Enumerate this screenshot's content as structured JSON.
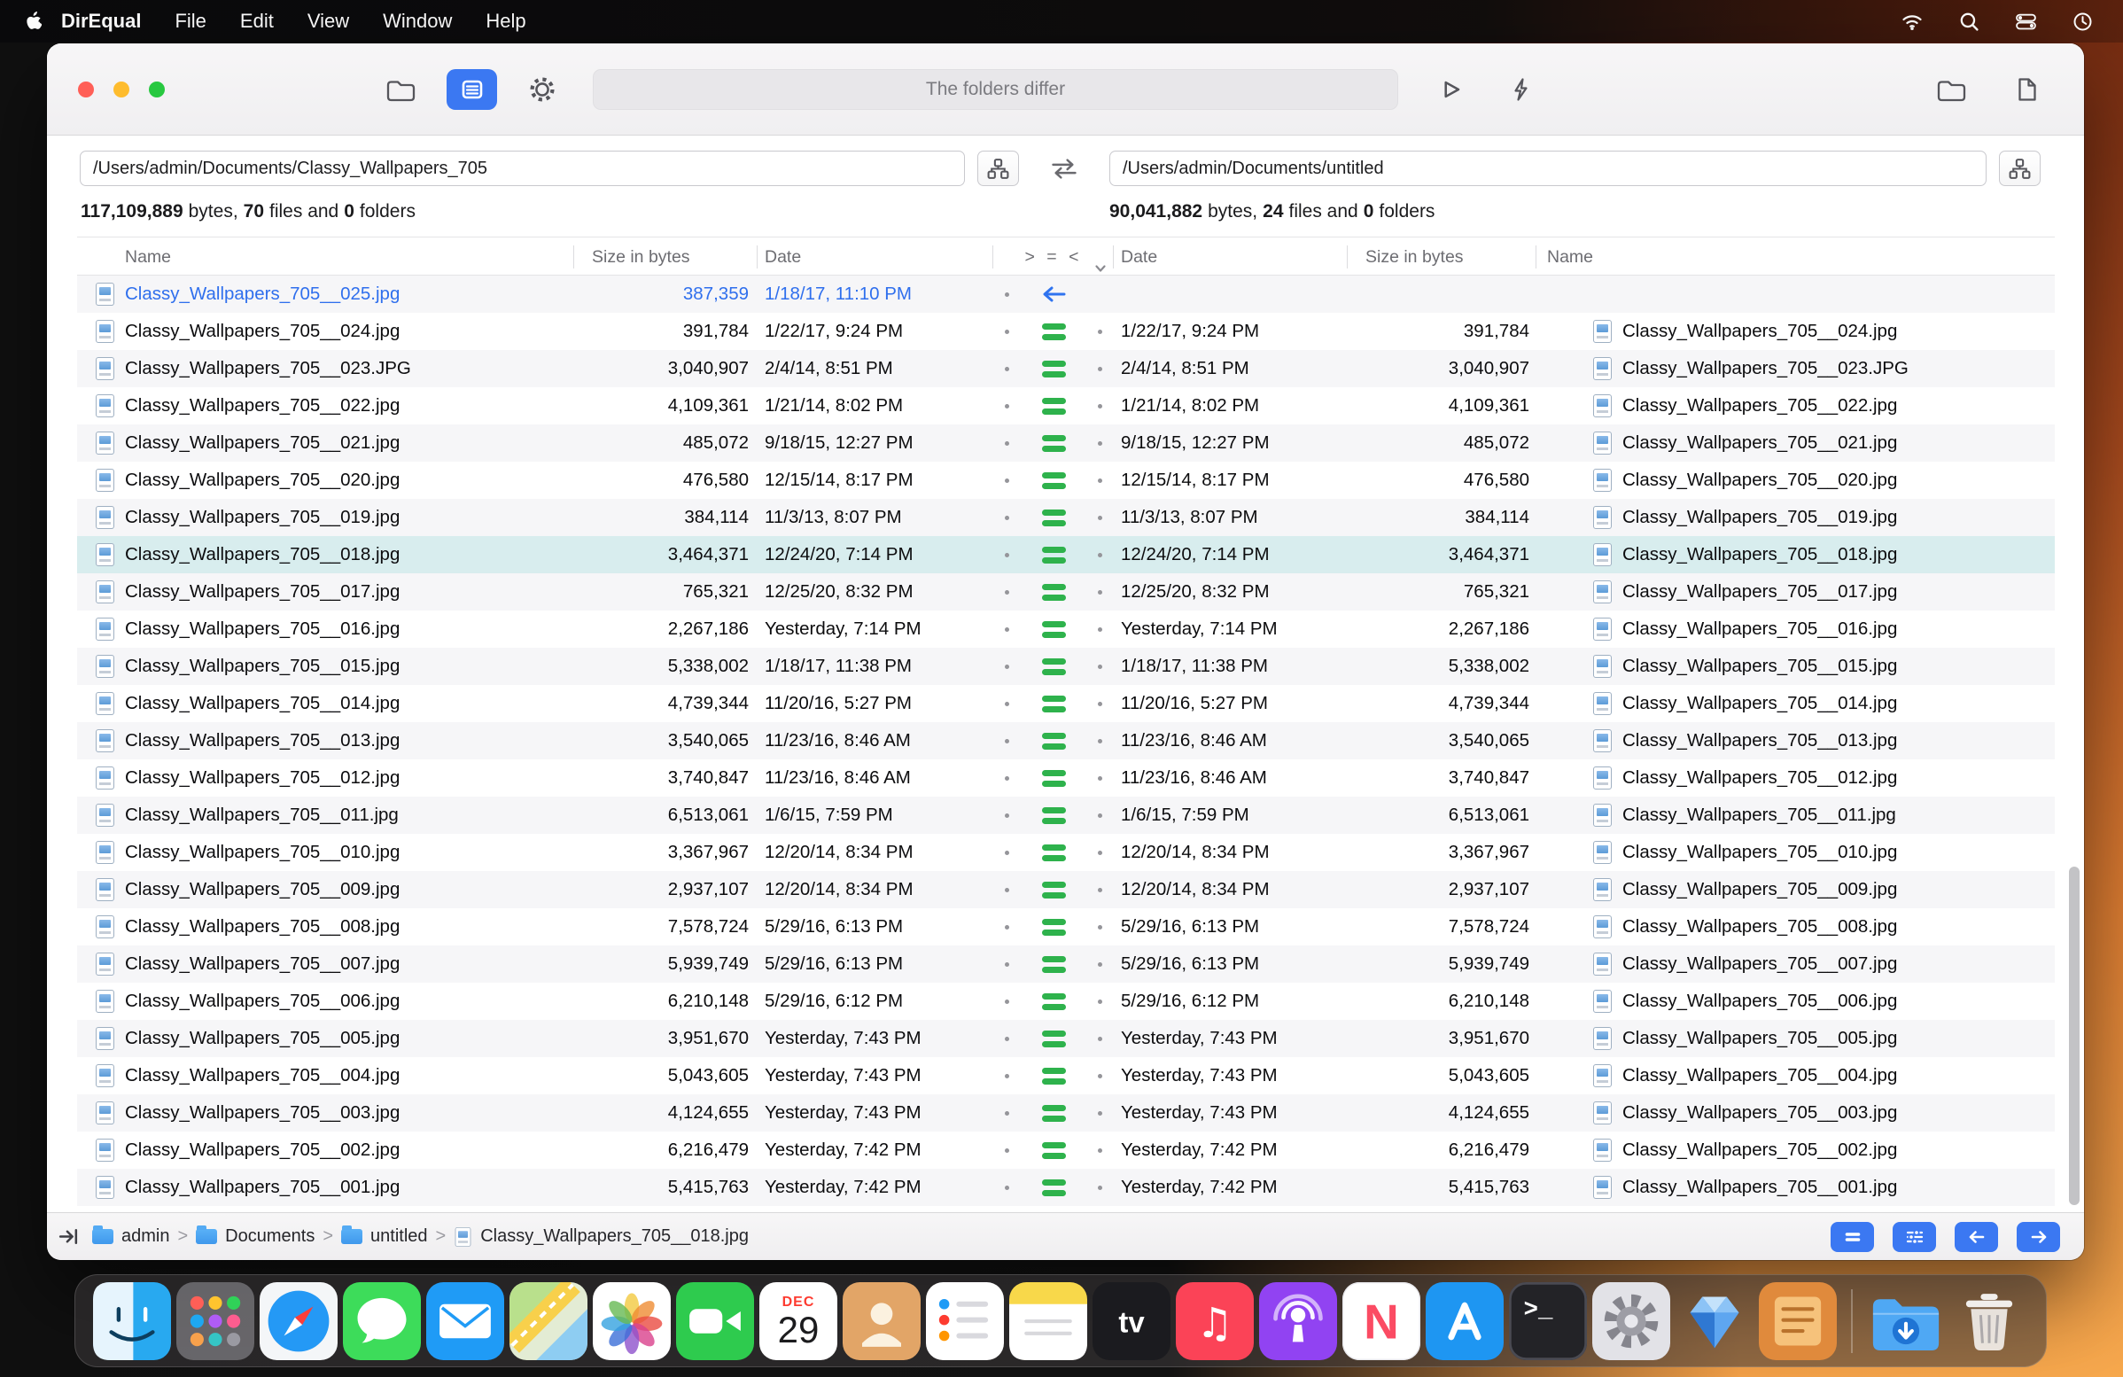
{
  "menubar": {
    "app_name": "DirEqual",
    "menus": [
      "File",
      "Edit",
      "View",
      "Window",
      "Help"
    ],
    "status_icons": [
      "wifi-icon",
      "spotlight-search-icon",
      "control-center-icon",
      "clock-icon"
    ]
  },
  "toolbar": {
    "status_message": "The folders differ",
    "buttons": [
      "select-folders",
      "compare-view",
      "settings",
      "run-compare",
      "quick-compare",
      "reveal-left-folder",
      "reveal-selected-file"
    ]
  },
  "panes": {
    "left": {
      "path": "/Users/admin/Documents/Classy_Wallpapers_705",
      "stats": {
        "bytes": "117,109,889",
        "bytes_label": "bytes,",
        "files": "70",
        "files_label": "files and",
        "folders": "0",
        "folders_label": "folders"
      }
    },
    "right": {
      "path": "/Users/admin/Documents/untitled",
      "stats": {
        "bytes": "90,041,882",
        "bytes_label": "bytes,",
        "files": "24",
        "files_label": "files and",
        "folders": "0",
        "folders_label": "folders"
      }
    }
  },
  "table": {
    "headers": {
      "name_left": "Name",
      "size_left": "Size in bytes",
      "date_left": "Date",
      "compare": "> = <",
      "date_right": "Date",
      "size_right": "Size in bytes",
      "name_right": "Name"
    },
    "rows": [
      {
        "status": "left_only",
        "selected": false,
        "left": {
          "name": "Classy_Wallpapers_705__025.jpg",
          "size": "387,359",
          "date": "1/18/17, 11:10 PM"
        },
        "right": null
      },
      {
        "status": "equal",
        "selected": false,
        "left": {
          "name": "Classy_Wallpapers_705__024.jpg",
          "size": "391,784",
          "date": "1/22/17, 9:24 PM"
        },
        "right": {
          "name": "Classy_Wallpapers_705__024.jpg",
          "size": "391,784",
          "date": "1/22/17, 9:24 PM"
        }
      },
      {
        "status": "equal",
        "selected": false,
        "left": {
          "name": "Classy_Wallpapers_705__023.JPG",
          "size": "3,040,907",
          "date": "2/4/14, 8:51 PM"
        },
        "right": {
          "name": "Classy_Wallpapers_705__023.JPG",
          "size": "3,040,907",
          "date": "2/4/14, 8:51 PM"
        }
      },
      {
        "status": "equal",
        "selected": false,
        "left": {
          "name": "Classy_Wallpapers_705__022.jpg",
          "size": "4,109,361",
          "date": "1/21/14, 8:02 PM"
        },
        "right": {
          "name": "Classy_Wallpapers_705__022.jpg",
          "size": "4,109,361",
          "date": "1/21/14, 8:02 PM"
        }
      },
      {
        "status": "equal",
        "selected": false,
        "left": {
          "name": "Classy_Wallpapers_705__021.jpg",
          "size": "485,072",
          "date": "9/18/15, 12:27 PM"
        },
        "right": {
          "name": "Classy_Wallpapers_705__021.jpg",
          "size": "485,072",
          "date": "9/18/15, 12:27 PM"
        }
      },
      {
        "status": "equal",
        "selected": false,
        "left": {
          "name": "Classy_Wallpapers_705__020.jpg",
          "size": "476,580",
          "date": "12/15/14, 8:17 PM"
        },
        "right": {
          "name": "Classy_Wallpapers_705__020.jpg",
          "size": "476,580",
          "date": "12/15/14, 8:17 PM"
        }
      },
      {
        "status": "equal",
        "selected": false,
        "left": {
          "name": "Classy_Wallpapers_705__019.jpg",
          "size": "384,114",
          "date": "11/3/13, 8:07 PM"
        },
        "right": {
          "name": "Classy_Wallpapers_705__019.jpg",
          "size": "384,114",
          "date": "11/3/13, 8:07 PM"
        }
      },
      {
        "status": "equal",
        "selected": true,
        "left": {
          "name": "Classy_Wallpapers_705__018.jpg",
          "size": "3,464,371",
          "date": "12/24/20, 7:14 PM"
        },
        "right": {
          "name": "Classy_Wallpapers_705__018.jpg",
          "size": "3,464,371",
          "date": "12/24/20, 7:14 PM"
        }
      },
      {
        "status": "equal",
        "selected": false,
        "left": {
          "name": "Classy_Wallpapers_705__017.jpg",
          "size": "765,321",
          "date": "12/25/20, 8:32 PM"
        },
        "right": {
          "name": "Classy_Wallpapers_705__017.jpg",
          "size": "765,321",
          "date": "12/25/20, 8:32 PM"
        }
      },
      {
        "status": "equal",
        "selected": false,
        "left": {
          "name": "Classy_Wallpapers_705__016.jpg",
          "size": "2,267,186",
          "date": "Yesterday, 7:14 PM"
        },
        "right": {
          "name": "Classy_Wallpapers_705__016.jpg",
          "size": "2,267,186",
          "date": "Yesterday, 7:14 PM"
        }
      },
      {
        "status": "equal",
        "selected": false,
        "left": {
          "name": "Classy_Wallpapers_705__015.jpg",
          "size": "5,338,002",
          "date": "1/18/17, 11:38 PM"
        },
        "right": {
          "name": "Classy_Wallpapers_705__015.jpg",
          "size": "5,338,002",
          "date": "1/18/17, 11:38 PM"
        }
      },
      {
        "status": "equal",
        "selected": false,
        "left": {
          "name": "Classy_Wallpapers_705__014.jpg",
          "size": "4,739,344",
          "date": "11/20/16, 5:27 PM"
        },
        "right": {
          "name": "Classy_Wallpapers_705__014.jpg",
          "size": "4,739,344",
          "date": "11/20/16, 5:27 PM"
        }
      },
      {
        "status": "equal",
        "selected": false,
        "left": {
          "name": "Classy_Wallpapers_705__013.jpg",
          "size": "3,540,065",
          "date": "11/23/16, 8:46 AM"
        },
        "right": {
          "name": "Classy_Wallpapers_705__013.jpg",
          "size": "3,540,065",
          "date": "11/23/16, 8:46 AM"
        }
      },
      {
        "status": "equal",
        "selected": false,
        "left": {
          "name": "Classy_Wallpapers_705__012.jpg",
          "size": "3,740,847",
          "date": "11/23/16, 8:46 AM"
        },
        "right": {
          "name": "Classy_Wallpapers_705__012.jpg",
          "size": "3,740,847",
          "date": "11/23/16, 8:46 AM"
        }
      },
      {
        "status": "equal",
        "selected": false,
        "left": {
          "name": "Classy_Wallpapers_705__011.jpg",
          "size": "6,513,061",
          "date": "1/6/15, 7:59 PM"
        },
        "right": {
          "name": "Classy_Wallpapers_705__011.jpg",
          "size": "6,513,061",
          "date": "1/6/15, 7:59 PM"
        }
      },
      {
        "status": "equal",
        "selected": false,
        "left": {
          "name": "Classy_Wallpapers_705__010.jpg",
          "size": "3,367,967",
          "date": "12/20/14, 8:34 PM"
        },
        "right": {
          "name": "Classy_Wallpapers_705__010.jpg",
          "size": "3,367,967",
          "date": "12/20/14, 8:34 PM"
        }
      },
      {
        "status": "equal",
        "selected": false,
        "left": {
          "name": "Classy_Wallpapers_705__009.jpg",
          "size": "2,937,107",
          "date": "12/20/14, 8:34 PM"
        },
        "right": {
          "name": "Classy_Wallpapers_705__009.jpg",
          "size": "2,937,107",
          "date": "12/20/14, 8:34 PM"
        }
      },
      {
        "status": "equal",
        "selected": false,
        "left": {
          "name": "Classy_Wallpapers_705__008.jpg",
          "size": "7,578,724",
          "date": "5/29/16, 6:13 PM"
        },
        "right": {
          "name": "Classy_Wallpapers_705__008.jpg",
          "size": "7,578,724",
          "date": "5/29/16, 6:13 PM"
        }
      },
      {
        "status": "equal",
        "selected": false,
        "left": {
          "name": "Classy_Wallpapers_705__007.jpg",
          "size": "5,939,749",
          "date": "5/29/16, 6:13 PM"
        },
        "right": {
          "name": "Classy_Wallpapers_705__007.jpg",
          "size": "5,939,749",
          "date": "5/29/16, 6:13 PM"
        }
      },
      {
        "status": "equal",
        "selected": false,
        "left": {
          "name": "Classy_Wallpapers_705__006.jpg",
          "size": "6,210,148",
          "date": "5/29/16, 6:12 PM"
        },
        "right": {
          "name": "Classy_Wallpapers_705__006.jpg",
          "size": "6,210,148",
          "date": "5/29/16, 6:12 PM"
        }
      },
      {
        "status": "equal",
        "selected": false,
        "left": {
          "name": "Classy_Wallpapers_705__005.jpg",
          "size": "3,951,670",
          "date": "Yesterday, 7:43 PM"
        },
        "right": {
          "name": "Classy_Wallpapers_705__005.jpg",
          "size": "3,951,670",
          "date": "Yesterday, 7:43 PM"
        }
      },
      {
        "status": "equal",
        "selected": false,
        "left": {
          "name": "Classy_Wallpapers_705__004.jpg",
          "size": "5,043,605",
          "date": "Yesterday, 7:43 PM"
        },
        "right": {
          "name": "Classy_Wallpapers_705__004.jpg",
          "size": "5,043,605",
          "date": "Yesterday, 7:43 PM"
        }
      },
      {
        "status": "equal",
        "selected": false,
        "left": {
          "name": "Classy_Wallpapers_705__003.jpg",
          "size": "4,124,655",
          "date": "Yesterday, 7:43 PM"
        },
        "right": {
          "name": "Classy_Wallpapers_705__003.jpg",
          "size": "4,124,655",
          "date": "Yesterday, 7:43 PM"
        }
      },
      {
        "status": "equal",
        "selected": false,
        "left": {
          "name": "Classy_Wallpapers_705__002.jpg",
          "size": "6,216,479",
          "date": "Yesterday, 7:42 PM"
        },
        "right": {
          "name": "Classy_Wallpapers_705__002.jpg",
          "size": "6,216,479",
          "date": "Yesterday, 7:42 PM"
        }
      },
      {
        "status": "equal",
        "selected": false,
        "left": {
          "name": "Classy_Wallpapers_705__001.jpg",
          "size": "5,415,763",
          "date": "Yesterday, 7:42 PM"
        },
        "right": {
          "name": "Classy_Wallpapers_705__001.jpg",
          "size": "5,415,763",
          "date": "Yesterday, 7:42 PM"
        }
      }
    ]
  },
  "bottom_bar": {
    "separator": ">",
    "breadcrumbs": [
      {
        "type": "folder",
        "label": "admin"
      },
      {
        "type": "folder",
        "label": "Documents"
      },
      {
        "type": "folder",
        "label": "untitled"
      },
      {
        "type": "file",
        "label": "Classy_Wallpapers_705__018.jpg"
      }
    ],
    "buttons": [
      "equal-filter-button",
      "filter-options-button",
      "previous-difference-button",
      "next-difference-button"
    ]
  },
  "dock": {
    "items": [
      {
        "name": "finder"
      },
      {
        "name": "launchpad"
      },
      {
        "name": "safari"
      },
      {
        "name": "messages"
      },
      {
        "name": "mail"
      },
      {
        "name": "maps"
      },
      {
        "name": "photos"
      },
      {
        "name": "facetime"
      },
      {
        "name": "calendar",
        "month": "DEC",
        "day": "29"
      },
      {
        "name": "contacts"
      },
      {
        "name": "reminders"
      },
      {
        "name": "notes"
      },
      {
        "name": "tv"
      },
      {
        "name": "music"
      },
      {
        "name": "podcasts"
      },
      {
        "name": "news"
      },
      {
        "name": "appstore"
      },
      {
        "name": "terminal"
      },
      {
        "name": "settings"
      },
      {
        "name": "direqual"
      },
      {
        "name": "orange-app"
      },
      {
        "name": "separator"
      },
      {
        "name": "downloads"
      },
      {
        "name": "trash"
      }
    ]
  },
  "colors": {
    "accent_blue": "#3b78f2",
    "equal_green": "#2eb24c",
    "selected_row": "#d8edee",
    "left_only_blue": "#2f6fed",
    "window_background": "#ffffff"
  }
}
